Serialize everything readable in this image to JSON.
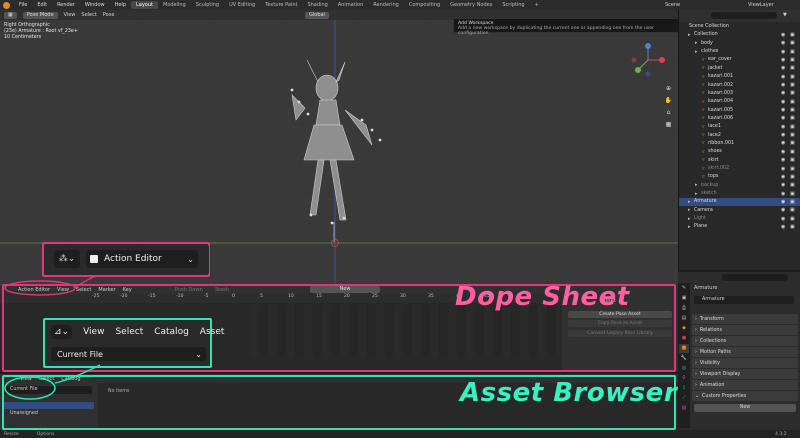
{
  "topbar": {
    "menus": [
      "File",
      "Edit",
      "Render",
      "Window",
      "Help"
    ],
    "tabs": [
      "Layout",
      "Modeling",
      "Sculpting",
      "UV Editing",
      "Texture Paint",
      "Shading",
      "Animation",
      "Rendering",
      "Compositing",
      "Geometry Nodes",
      "Scripting"
    ],
    "active_tab": "Layout",
    "scene_label": "Scene",
    "viewlayer_label": "ViewLayer"
  },
  "viewport": {
    "mode": "Pose Mode",
    "menus": [
      "View",
      "Select",
      "Pose"
    ],
    "transform_orientation": "Global",
    "info_lines": [
      "Right Orthographic",
      "(23e) Armature : Root vf_23e+",
      "10 Centimeters"
    ]
  },
  "tooltip": {
    "title": "Add Workspace",
    "body": "Add a new workspace by duplicating the current one or appending one from the user configuration."
  },
  "outliner": {
    "root": "Scene Collection",
    "items": [
      {
        "name": "Collection",
        "indent": 1
      },
      {
        "name": "body",
        "indent": 2
      },
      {
        "name": "clothes",
        "indent": 2
      },
      {
        "name": "ear_cover",
        "indent": 3
      },
      {
        "name": "jacket",
        "indent": 3
      },
      {
        "name": "kazari.001",
        "indent": 3
      },
      {
        "name": "kazari.002",
        "indent": 3
      },
      {
        "name": "kazari.003",
        "indent": 3
      },
      {
        "name": "kazari.004",
        "indent": 3
      },
      {
        "name": "kazari.005",
        "indent": 3
      },
      {
        "name": "kazari.006",
        "indent": 3
      },
      {
        "name": "lace1",
        "indent": 3
      },
      {
        "name": "lace2",
        "indent": 3
      },
      {
        "name": "ribbon.001",
        "indent": 3
      },
      {
        "name": "shoes",
        "indent": 3
      },
      {
        "name": "skirt",
        "indent": 3
      },
      {
        "name": "skirt.002",
        "indent": 3
      },
      {
        "name": "tops",
        "indent": 3
      },
      {
        "name": "backup",
        "indent": 2
      },
      {
        "name": "sketch",
        "indent": 2
      },
      {
        "name": "Armature",
        "indent": 1
      },
      {
        "name": "Camera",
        "indent": 1
      },
      {
        "name": "Light",
        "indent": 1
      },
      {
        "name": "Plane",
        "indent": 1
      }
    ],
    "selected": "Armature"
  },
  "properties": {
    "object_name": "Armature",
    "data_name": "Armature",
    "panels": [
      "Transform",
      "Relations",
      "Collections",
      "Motion Paths",
      "Visibility",
      "Viewport Display",
      "Animation",
      "Custom Properties"
    ],
    "new_button": "New"
  },
  "dopesheet": {
    "editor_label": "Action Editor",
    "menus": [
      "View",
      "Select",
      "Marker",
      "Key"
    ],
    "push_down": "Push Down",
    "stash": "Stash",
    "new_label": "New",
    "frames": [
      "-25",
      "-20",
      "-15",
      "-10",
      "-5",
      "0",
      "5",
      "10",
      "15",
      "20",
      "25",
      "30",
      "35",
      "40",
      "45"
    ],
    "side_title": "Asset",
    "side_buttons": [
      "Create Pose Asset",
      "Copy Pose as Asset",
      "Convert Legacy Pose Library"
    ]
  },
  "assetbrowser": {
    "menus": [
      "View",
      "Select",
      "Catalog"
    ],
    "library": "Current File",
    "catalog_item": "Unassigned",
    "no_items": "No items"
  },
  "status": {
    "left": "Resize",
    "right_opt": "Options",
    "version": "4.3.2"
  },
  "callouts": {
    "action_editor": "Action Editor",
    "menus": [
      "View",
      "Select",
      "Catalog",
      "Asset"
    ],
    "library": "Current File"
  },
  "annotations": {
    "dope_sheet": "Dope Sheet",
    "asset_browser": "Asset Browser"
  },
  "colors": {
    "pink": "#e0377a",
    "teal": "#2ee5b3",
    "selection": "#334d80",
    "accent_orange": "#e08a2c"
  }
}
